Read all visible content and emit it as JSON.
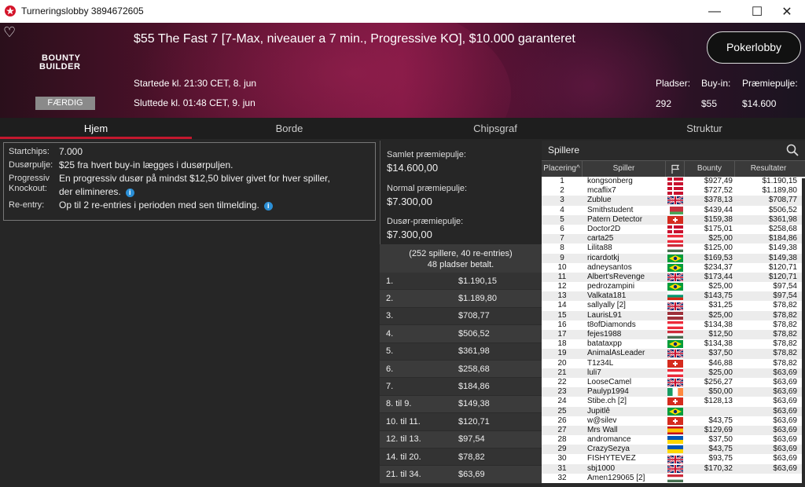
{
  "window": {
    "title": "Turneringslobby 3894672605",
    "min": "—",
    "max": "☐",
    "close": "✕"
  },
  "header": {
    "event_title": "$55 The Fast 7 [7-Max, niveauer a 7 min., Progressive KO], $10.000 garanteret",
    "logo_line1": "BOUNTY",
    "logo_line2": "BUILDER",
    "status": "FÆRDIG",
    "start": "Startede kl. 21:30 CET, 8. jun",
    "end": "Sluttede kl. 01:48 CET, 9. jun",
    "lobby_button": "Pokerlobby",
    "seats_label": "Pladser:",
    "seats_value": "292",
    "buyin_label": "Buy-in:",
    "buyin_value": "$55",
    "prize_label": "Præmiepulje:",
    "prize_value": "$14.600"
  },
  "tabs": [
    "Hjem",
    "Borde",
    "Chipsgraf",
    "Struktur"
  ],
  "info": {
    "startchips_label": "Startchips:",
    "startchips_value": "7.000",
    "bountypool_label": "Dusørpulje:",
    "bountypool_value": "$25 fra hvert buy-in lægges i dusørpuljen.",
    "pko_label1": "Progressiv",
    "pko_label2": "Knockout:",
    "pko_value1": "En progressiv dusør på mindst $12,50 bliver givet for hver spiller,",
    "pko_value2": "der elimineres.",
    "reentry_label": "Re-entry:",
    "reentry_value": "Op til 2 re-entries i perioden med sen tilmelding."
  },
  "pool": {
    "total_label": "Samlet præmiepulje:",
    "total_value": "$14.600,00",
    "normal_label": "Normal præmiepulje:",
    "normal_value": "$7.300,00",
    "bounty_label": "Dusør-præmiepulje:",
    "bounty_value": "$7.300,00",
    "summary1": "(252 spillere, 40 re-entries)",
    "summary2": "48 pladser betalt."
  },
  "payouts": [
    {
      "place": "1.",
      "amount": "$1.190,15"
    },
    {
      "place": "2.",
      "amount": "$1.189,80"
    },
    {
      "place": "3.",
      "amount": "$708,77"
    },
    {
      "place": "4.",
      "amount": "$506,52"
    },
    {
      "place": "5.",
      "amount": "$361,98"
    },
    {
      "place": "6.",
      "amount": "$258,68"
    },
    {
      "place": "7.",
      "amount": "$184,86"
    },
    {
      "place": "8. til 9.",
      "amount": "$149,38"
    },
    {
      "place": "10. til 11.",
      "amount": "$120,71"
    },
    {
      "place": "12. til 13.",
      "amount": "$97,54"
    },
    {
      "place": "14. til 20.",
      "amount": "$78,82"
    },
    {
      "place": "21. til 34.",
      "amount": "$63,69"
    }
  ],
  "players": {
    "search_label": "Spillere",
    "col_place": "Placering",
    "col_player": "Spiller",
    "col_bounty": "Bounty",
    "col_result": "Resultater",
    "rows": [
      {
        "p": "1",
        "n": "kongsonberg",
        "f": "dk",
        "b": "$927,49",
        "r": "$1.190,15"
      },
      {
        "p": "2",
        "n": "mcaflix7",
        "f": "dk",
        "b": "$727,52",
        "r": "$1.189,80"
      },
      {
        "p": "3",
        "n": "Zublue",
        "f": "gb",
        "b": "$378,13",
        "r": "$708,77"
      },
      {
        "p": "4",
        "n": "Smithstudent",
        "f": "by",
        "b": "$439,44",
        "r": "$506,52"
      },
      {
        "p": "5",
        "n": "Patern Detector",
        "f": "ch",
        "b": "$159,38",
        "r": "$361,98"
      },
      {
        "p": "6",
        "n": "Doctor2D",
        "f": "dk",
        "b": "$175,01",
        "r": "$258,68"
      },
      {
        "p": "7",
        "n": "carta25",
        "f": "at",
        "b": "$25,00",
        "r": "$184,86"
      },
      {
        "p": "8",
        "n": "Lilita88",
        "f": "hu",
        "b": "$125,00",
        "r": "$149,38"
      },
      {
        "p": "9",
        "n": "ricardotkj",
        "f": "br",
        "b": "$169,53",
        "r": "$149,38"
      },
      {
        "p": "10",
        "n": "adneysantos",
        "f": "br",
        "b": "$234,37",
        "r": "$120,71"
      },
      {
        "p": "11",
        "n": "Albert'sRevenge",
        "f": "gb",
        "b": "$173,44",
        "r": "$120,71"
      },
      {
        "p": "12",
        "n": "pedrozampini",
        "f": "br",
        "b": "$25,00",
        "r": "$97,54"
      },
      {
        "p": "13",
        "n": "Valkata181",
        "f": "bg",
        "b": "$143,75",
        "r": "$97,54"
      },
      {
        "p": "14",
        "n": "sallyally [2]",
        "f": "gb",
        "b": "$31,25",
        "r": "$78,82"
      },
      {
        "p": "15",
        "n": "LaurisL91",
        "f": "lv",
        "b": "$25,00",
        "r": "$78,82"
      },
      {
        "p": "16",
        "n": "t8ofDiamonds",
        "f": "at",
        "b": "$134,38",
        "r": "$78,82"
      },
      {
        "p": "17",
        "n": "fejes1988",
        "f": "hu",
        "b": "$12,50",
        "r": "$78,82"
      },
      {
        "p": "18",
        "n": "batataxpp",
        "f": "br",
        "b": "$134,38",
        "r": "$78,82"
      },
      {
        "p": "19",
        "n": "AnimalAsLeader",
        "f": "gb",
        "b": "$37,50",
        "r": "$78,82"
      },
      {
        "p": "20",
        "n": "T1z34L",
        "f": "ch",
        "b": "$46,88",
        "r": "$78,82"
      },
      {
        "p": "21",
        "n": "luli7",
        "f": "at",
        "b": "$25,00",
        "r": "$63,69"
      },
      {
        "p": "22",
        "n": "LooseCamel",
        "f": "gb",
        "b": "$256,27",
        "r": "$63,69"
      },
      {
        "p": "23",
        "n": "Paulyp1994",
        "f": "ie",
        "b": "$50,00",
        "r": "$63,69"
      },
      {
        "p": "24",
        "n": "Stibe.ch [2]",
        "f": "ch",
        "b": "$128,13",
        "r": "$63,69"
      },
      {
        "p": "25",
        "n": "Jupitlê",
        "f": "br",
        "b": "",
        "r": "$63,69"
      },
      {
        "p": "26",
        "n": "w@silev",
        "f": "ch",
        "b": "$43,75",
        "r": "$63,69"
      },
      {
        "p": "27",
        "n": "Mrs Wall",
        "f": "es",
        "b": "$129,69",
        "r": "$63,69"
      },
      {
        "p": "28",
        "n": "andromance",
        "f": "ua",
        "b": "$37,50",
        "r": "$63,69"
      },
      {
        "p": "29",
        "n": "CrazySezya",
        "f": "ua",
        "b": "$43,75",
        "r": "$63,69"
      },
      {
        "p": "30",
        "n": "FISHYTEVEZ",
        "f": "gb",
        "b": "$93,75",
        "r": "$63,69"
      },
      {
        "p": "31",
        "n": "sbj1000",
        "f": "gb",
        "b": "$170,32",
        "r": "$63,69"
      },
      {
        "p": "32",
        "n": "Amen129065 [2]",
        "f": "hu",
        "b": "",
        "r": ""
      }
    ]
  }
}
